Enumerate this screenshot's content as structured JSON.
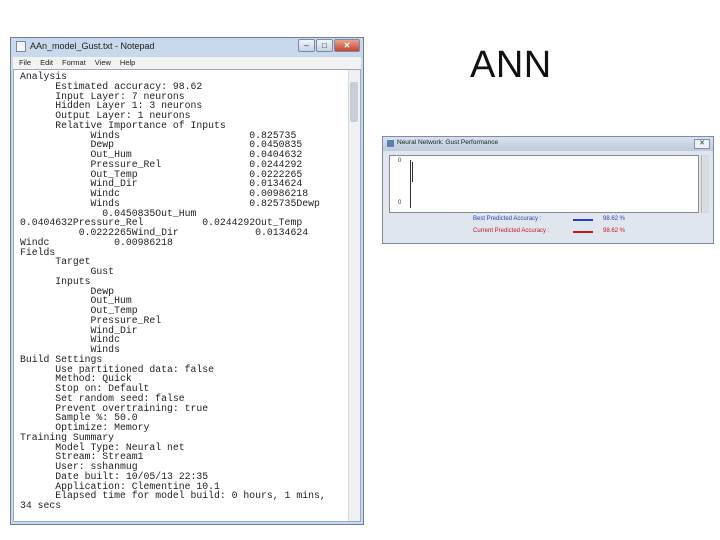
{
  "notepad": {
    "title": "AAn_model_Gust.txt - Notepad",
    "controls": {
      "minimize": "‒",
      "maximize": "□",
      "close": "✕"
    },
    "menu": [
      "File",
      "Edit",
      "Format",
      "View",
      "Help"
    ],
    "content": "Analysis\n      Estimated accuracy: 98.62\n      Input Layer: 7 neurons\n      Hidden Layer 1: 3 neurons\n      Output Layer: 1 neurons\n      Relative Importance of Inputs\n            Winds                      0.825735\n            Dewp                       0.0450835\n            Out_Hum                    0.0404632\n            Pressure_Rel               0.0244292\n            Out_Temp                   0.0222265\n            Wind_Dir                   0.0134624\n            Windc                      0.00986218\n            Winds                      0.825735Dewp\n              0.0450835Out_Hum\n0.0404632Pressure_Rel          0.0244292Out_Temp\n          0.0222265Wind_Dir             0.0134624\nWindc           0.00986218\nFields\n      Target\n            Gust\n      Inputs\n            Dewp\n            Out_Hum\n            Out_Temp\n            Pressure_Rel\n            Wind_Dir\n            Windc\n            Winds\nBuild Settings\n      Use partitioned data: false\n      Method: Quick\n      Stop on: Default\n      Set random seed: false\n      Prevent overtraining: true\n      Sample %: 50.0\n      Optimize: Memory\nTraining Summary\n      Model Type: Neural net\n      Stream: Stream1\n      User: sshanmug\n      Date built: 10/05/13 22:35\n      Application: Clementine 10.1\n      Elapsed time for model build: 0 hours, 1 mins,\n34 secs"
  },
  "slide": {
    "title": "ANN"
  },
  "nn_window": {
    "title": "Neural Network: Gust Performance",
    "close": "✕",
    "ticks": [
      "0",
      "0"
    ],
    "legend": [
      {
        "label": "Best Predicted Accuracy :",
        "value": "98.62 %",
        "color": "#2a3fb0"
      },
      {
        "label": "Current Predicted Accuracy :",
        "value": "98.62 %",
        "color": "#c8161d"
      }
    ]
  }
}
